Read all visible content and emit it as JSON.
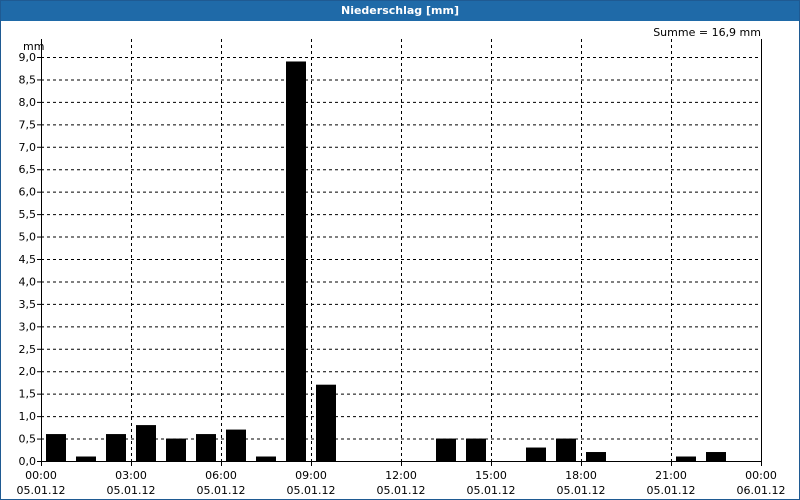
{
  "window": {
    "title": "Niederschlag [mm]"
  },
  "chart_data": {
    "type": "bar",
    "title": "Niederschlag [mm]",
    "ylabel": "mm",
    "annotation": "Summe = 16,9 mm",
    "ylim": [
      0,
      9.0
    ],
    "yticks": [
      "0,0",
      "0,5",
      "1,0",
      "1,5",
      "2,0",
      "2,5",
      "3,0",
      "3,5",
      "4,0",
      "4,5",
      "5,0",
      "5,5",
      "6,0",
      "6,5",
      "7,0",
      "7,5",
      "8,0",
      "8,5",
      "9,0"
    ],
    "xticks": [
      {
        "time": "00:00",
        "date": "05.01.12"
      },
      {
        "time": "03:00",
        "date": "05.01.12"
      },
      {
        "time": "06:00",
        "date": "05.01.12"
      },
      {
        "time": "09:00",
        "date": "05.01.12"
      },
      {
        "time": "12:00",
        "date": "05.01.12"
      },
      {
        "time": "15:00",
        "date": "05.01.12"
      },
      {
        "time": "18:00",
        "date": "05.01.12"
      },
      {
        "time": "21:00",
        "date": "05.01.12"
      },
      {
        "time": "00:00",
        "date": "06.01.12"
      }
    ],
    "interval_minutes": 60,
    "grid": true,
    "values": [
      0.6,
      0.1,
      0.6,
      0.8,
      0.5,
      0.6,
      0.7,
      0.1,
      8.9,
      1.7,
      0,
      0,
      0,
      0.5,
      0.5,
      0,
      0.3,
      0.5,
      0.2,
      0,
      0,
      0.1,
      0.2,
      0
    ],
    "bar_color": "#000000"
  }
}
